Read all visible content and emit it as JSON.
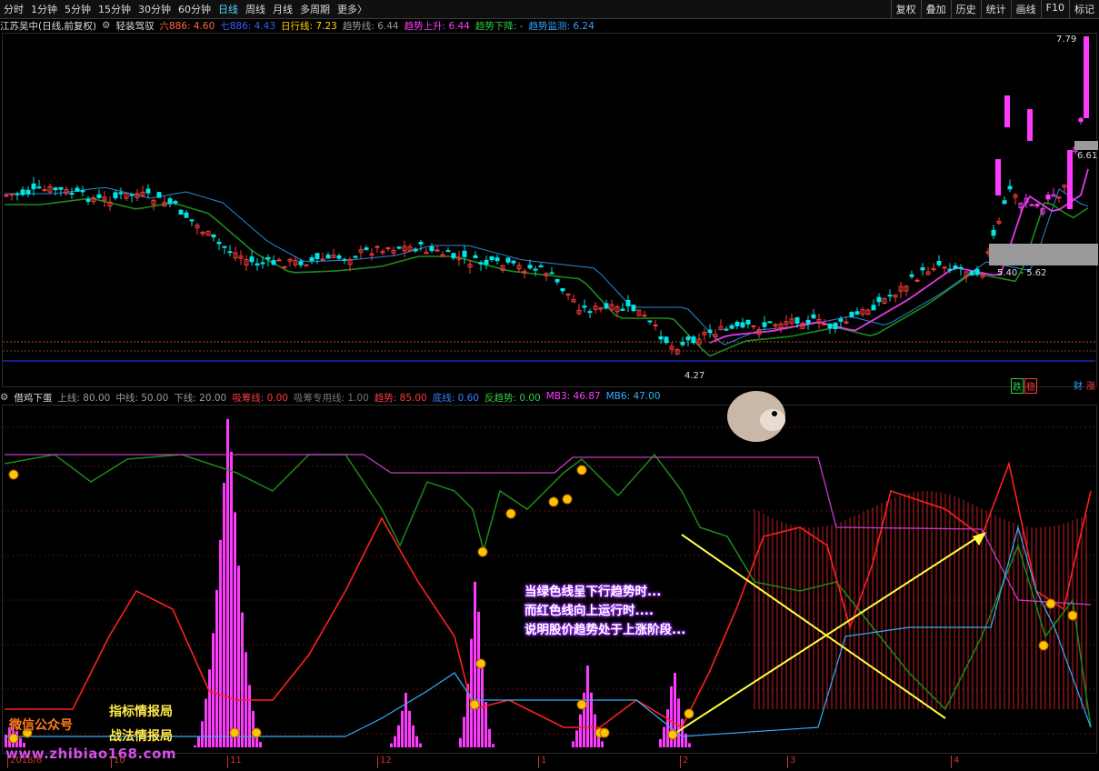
{
  "toolbar": {
    "periods": [
      {
        "label": "分时",
        "active": false
      },
      {
        "label": "1分钟",
        "active": false
      },
      {
        "label": "5分钟",
        "active": false
      },
      {
        "label": "15分钟",
        "active": false
      },
      {
        "label": "30分钟",
        "active": false
      },
      {
        "label": "60分钟",
        "active": false
      },
      {
        "label": "日线",
        "active": true
      },
      {
        "label": "周线",
        "active": false
      },
      {
        "label": "月线",
        "active": false
      },
      {
        "label": "多周期",
        "active": false
      },
      {
        "label": "更多〉",
        "active": false
      }
    ],
    "right_buttons": [
      "复权",
      "叠加",
      "历史",
      "统计",
      "画线",
      "F10",
      "标记"
    ]
  },
  "main_panel": {
    "stock_title": "江苏吴中(日线,前复权)",
    "indicator_name": "轻装驾驭",
    "values": [
      {
        "text": "六886: 4.60",
        "color": "#ff6a3a"
      },
      {
        "text": "七886: 4.43",
        "color": "#3a5cff"
      },
      {
        "text": "日行线: 7.23",
        "color": "#ffd700"
      },
      {
        "text": "趋势线: 6.44",
        "color": "#9a9a9a"
      },
      {
        "text": "趋势上升: 6.44",
        "color": "#ff3aff"
      },
      {
        "text": "趋势下降: -",
        "color": "#2ecc40"
      },
      {
        "text": "趋势监测: 6.24",
        "color": "#30a0ff"
      }
    ],
    "price_high": "7.79",
    "price_mid": "6.61",
    "price_low": "4.27",
    "price_range": "5.40 - 5.62",
    "tag_die": "跌",
    "tag_wen": "稳",
    "tag_cai": "财",
    "tag_zhang": "涨"
  },
  "sub_panel": {
    "indicator_name": "借鸡下蛋",
    "values": [
      {
        "text": "上线: 80.00",
        "color": "#9a9a9a"
      },
      {
        "text": "中线: 50.00",
        "color": "#9a9a9a"
      },
      {
        "text": "下线: 20.00",
        "color": "#9a9a9a"
      },
      {
        "text": "吸筹线: 0.00",
        "color": "#ff3a3a"
      },
      {
        "text": "吸筹专用线: 1.00",
        "color": "#777777"
      },
      {
        "text": "趋势: 85.00",
        "color": "#ff3a3a"
      },
      {
        "text": "底线: 0.60",
        "color": "#3a7cff"
      },
      {
        "text": "反趋势: 0.00",
        "color": "#2ecc40"
      },
      {
        "text": "MB3: 46.87",
        "color": "#ff3aff"
      },
      {
        "text": "MB6: 47.00",
        "color": "#30b0ff"
      }
    ]
  },
  "annotation": {
    "line1": "当绿色线呈下行趋势时...",
    "line2": "而红色线向上运行时....",
    "line3": "说明股价趋势处于上涨阶段..."
  },
  "watermark": {
    "wechat": "微信公众号",
    "name1": "指标情报局",
    "name2": "战法情报局",
    "url": "www.zhibiao168.com"
  },
  "x_axis": [
    "2018/8",
    "10",
    "11",
    "12",
    "1",
    "2",
    "3",
    "4"
  ],
  "colors": {
    "accent_active": "#4fd4ff",
    "up": "#ff3a3a",
    "down": "#00ffff"
  }
}
